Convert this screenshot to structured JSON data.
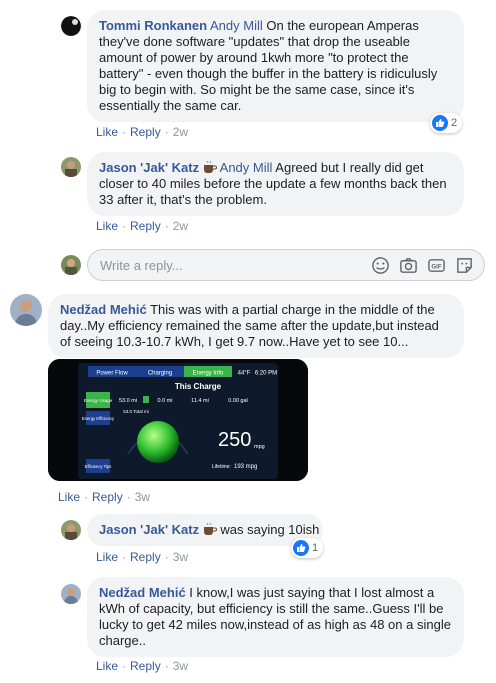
{
  "comments": [
    {
      "author": "Tommi Ronkanen",
      "mention": "Andy Mill",
      "text": " On the european Amperas they've done software \"updates\" that drop the useable amount of power by around 1kwh more \"to protect the battery\" - even though the buffer in the battery is ridiculusly big to begin with. So might be the same case, since it's essentially the same car.",
      "like": "Like",
      "reply": "Reply",
      "time": "2w",
      "reactions": "2"
    },
    {
      "author": "Jason 'Jak' Katz",
      "mention": "Andy Mill",
      "text": " Agreed but I really did get closer to 40 miles before the update a few months back then 33 after it, that's the problem.",
      "like": "Like",
      "reply": "Reply",
      "time": "2w"
    },
    {
      "author": "Nedžad Mehić",
      "text": " This was with a partial charge in the middle of the day..My efficiency remained the same after the update,but instead of seeing 10.3-10.7 kWh, I get 9.7 now..Have yet to see 10...",
      "like": "Like",
      "reply": "Reply",
      "time": "3w"
    },
    {
      "author": "Jason 'Jak' Katz",
      "text": " was saying 10ish",
      "like": "Like",
      "reply": "Reply",
      "time": "3w",
      "reactions": "1"
    },
    {
      "author": "Nedžad Mehić",
      "text": " I know,I was just saying that I lost almost a kWh of capacity, but efficiency is still the same..Guess I'll be lucky to get 42 miles now,instead of as high as 48 on a single charge..",
      "like": "Like",
      "reply": "Reply",
      "time": "3w"
    }
  ],
  "reply_box": {
    "placeholder": "Write a reply..."
  },
  "photo": {
    "tabs": [
      "Power Flow",
      "Charging",
      "Energy Info"
    ],
    "temp": "44°F",
    "clock": "6:20 PM",
    "heading": "This Charge",
    "energy_usage_label": "Energy Usage",
    "row_values": [
      "53.0 mi",
      "0.0 mi",
      "11.4 mi",
      "0.00 gal"
    ],
    "total": "53.0 Total mi",
    "efficiency_label": "Energy Efficiency",
    "mpg": "250",
    "mpg_unit": "mpg",
    "lifetime_label": "Lifetime:",
    "lifetime_value": "193 mpg",
    "tips_label": "Efficiency Tips"
  },
  "colors": {
    "link": "#385898",
    "bubble": "#f2f3f5",
    "like_blue": "#1877f2"
  },
  "icons": [
    "emoji-icon",
    "camera-icon",
    "gif-icon",
    "sticker-icon",
    "coffee-icon",
    "like-icon"
  ]
}
